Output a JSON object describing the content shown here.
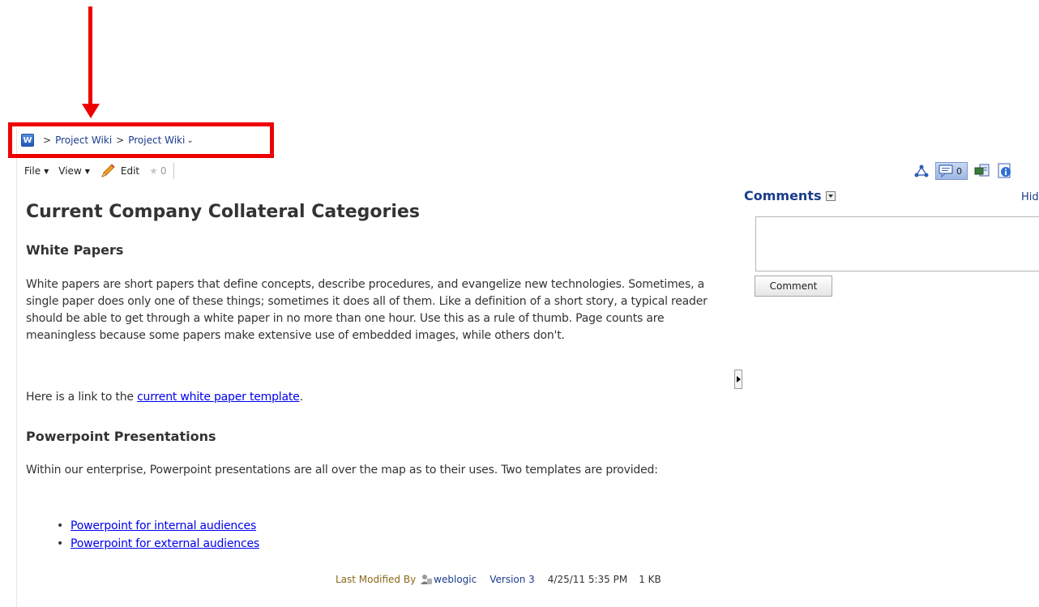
{
  "breadcrumb": {
    "icon_letter": "W",
    "separator": ">",
    "items": [
      "Project Wiki",
      "Project Wiki"
    ],
    "caret": "⌄"
  },
  "toolbar": {
    "file_label": "File",
    "view_label": "View",
    "edit_label": "Edit",
    "rating_count": "0",
    "dropdown_glyph": "▼"
  },
  "content": {
    "title": "Current Company Collateral Categories",
    "sections": [
      {
        "heading": "White Papers",
        "paragraph": "White papers are short papers that define concepts, describe procedures, and evangelize new technologies. Sometimes, a single paper does only one of these things; sometimes it does all of them. Like a definition of a short story, a typical reader should be able to get through a white paper in no more than one hour. Use this as a rule of thumb. Page counts are meaningless because some papers make extensive use of embedded images, while others don't.",
        "link_prefix": "Here is a link to the ",
        "link_text": "current white paper template",
        "link_suffix": "."
      },
      {
        "heading": "Powerpoint Presentations",
        "paragraph": "Within our enterprise, Powerpoint presentations are all over the map as to their uses. Two templates are provided:",
        "links": [
          "Powerpoint for internal audiences",
          "Powerpoint for external audiences"
        ]
      }
    ]
  },
  "footer": {
    "last_modified_label": "Last Modified By",
    "user": "weblogic",
    "version": "Version 3",
    "date": "4/25/11 5:35 PM",
    "size": "1 KB"
  },
  "sidebar": {
    "comment_count": "0",
    "comments_title": "Comments",
    "hide_label": "Hid",
    "comment_button": "Comment",
    "comment_input_value": ""
  },
  "annotation": {
    "color": "#ee0000"
  },
  "colors": {
    "link": "#0000ee",
    "nav_link": "#1a3c8c",
    "text": "#333333"
  }
}
